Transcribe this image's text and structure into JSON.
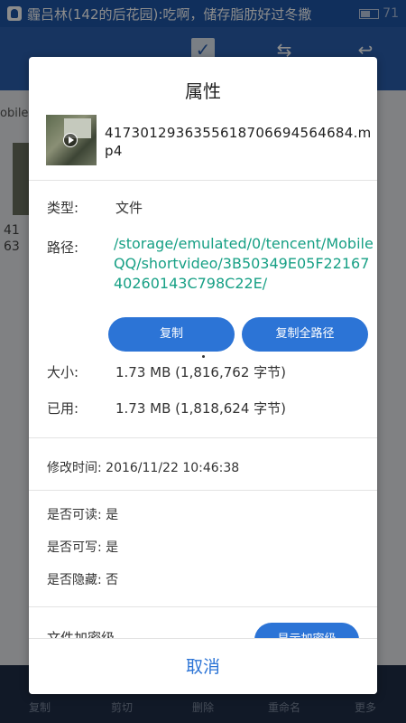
{
  "status_bar": {
    "notification_text": "霾吕林(142的后花园):吃啊，储存脂肪好过冬撒",
    "battery_text": "71"
  },
  "app_bar": {
    "icons": [
      "check-icon",
      "swap-icon",
      "back-icon"
    ]
  },
  "background": {
    "path_text": "obile",
    "file_num_partial": [
      "41",
      "63"
    ]
  },
  "bottom_bar": {
    "items": [
      "复制",
      "剪切",
      "删除",
      "重命名",
      "更多"
    ]
  },
  "dialog": {
    "title": "属性",
    "file_name": "4173012936355618706694564684.mp4",
    "type_label": "类型:",
    "type_value": "文件",
    "path_label": "路径:",
    "path_value": "/storage/emulated/0/tencent/MobileQQ/shortvideo/3B50349E05F2216740260143C798C22E/",
    "copy_button": "复制",
    "copy_full_path_button": "复制全路径",
    "size_label": "大小:",
    "size_value": "1.73 MB (1,816,762 字节)",
    "used_label": "已用:",
    "used_value": "1.73 MB (1,818,624 字节)",
    "modified_label": "修改时间:",
    "modified_value": "2016/11/22 10:46:38",
    "readable_label": "是否可读:",
    "readable_value": "是",
    "writable_label": "是否可写:",
    "writable_value": "是",
    "hidden_label": "是否隐藏:",
    "hidden_value": "否",
    "encryption_label": "文件加密级",
    "encryption_button": "显示加密级",
    "cancel_button": "取消"
  },
  "colors": {
    "accent": "#2c74d6",
    "path_text": "#17a085",
    "status_bar": "#1e56a8"
  }
}
